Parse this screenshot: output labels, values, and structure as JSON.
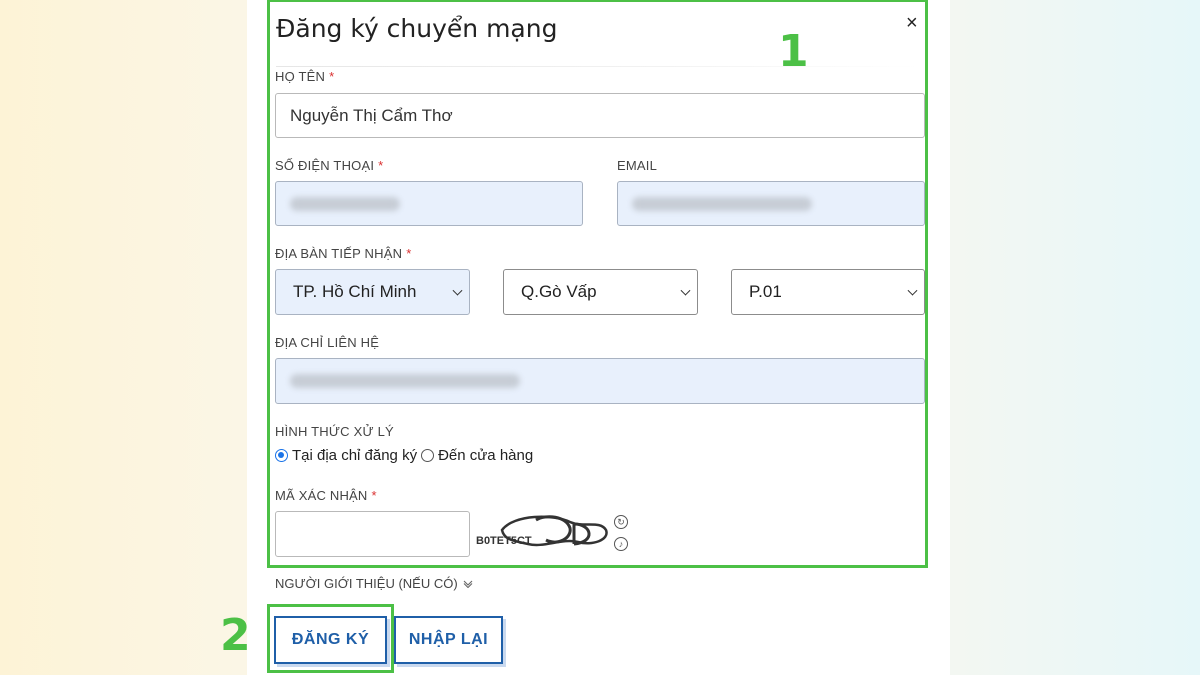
{
  "form": {
    "title": "Đăng ký chuyển mạng",
    "close_symbol": "×",
    "required_mark": "*",
    "name": {
      "label": "HỌ TÊN",
      "value": "Nguyễn Thị Cẩm Thơ"
    },
    "phone": {
      "label": "SỐ ĐIỆN THOẠI"
    },
    "email": {
      "label": "EMAIL"
    },
    "area": {
      "label": "ĐỊA BÀN TIẾP NHẬN",
      "province": "TP. Hồ Chí Minh",
      "district": "Q.Gò Vấp",
      "ward": "P.01"
    },
    "address": {
      "label": "ĐỊA CHỈ LIÊN HỆ"
    },
    "method": {
      "label": "HÌNH THỨC XỬ LÝ",
      "options": [
        "Tại địa chỉ đăng ký",
        "Đến cửa hàng"
      ],
      "selected_index": 0
    },
    "captcha": {
      "label": "MÃ XÁC NHẬN",
      "image_text": "B0TET5CT"
    },
    "referrer": {
      "label": "NGƯỜI GIỚI THIỆU (NẾU CÓ)"
    },
    "buttons": {
      "submit": "ĐĂNG KÝ",
      "reset": "NHẬP LẠI"
    }
  },
  "annotations": {
    "step1": "1",
    "step2": "2"
  },
  "colors": {
    "accent": "#1f5fa8",
    "highlight": "#4cc046",
    "required": "#d93030",
    "autofill_bg": "#e8f0fc"
  },
  "icons": [
    "close-icon",
    "chevron-down-icon",
    "refresh-icon",
    "audio-icon"
  ]
}
